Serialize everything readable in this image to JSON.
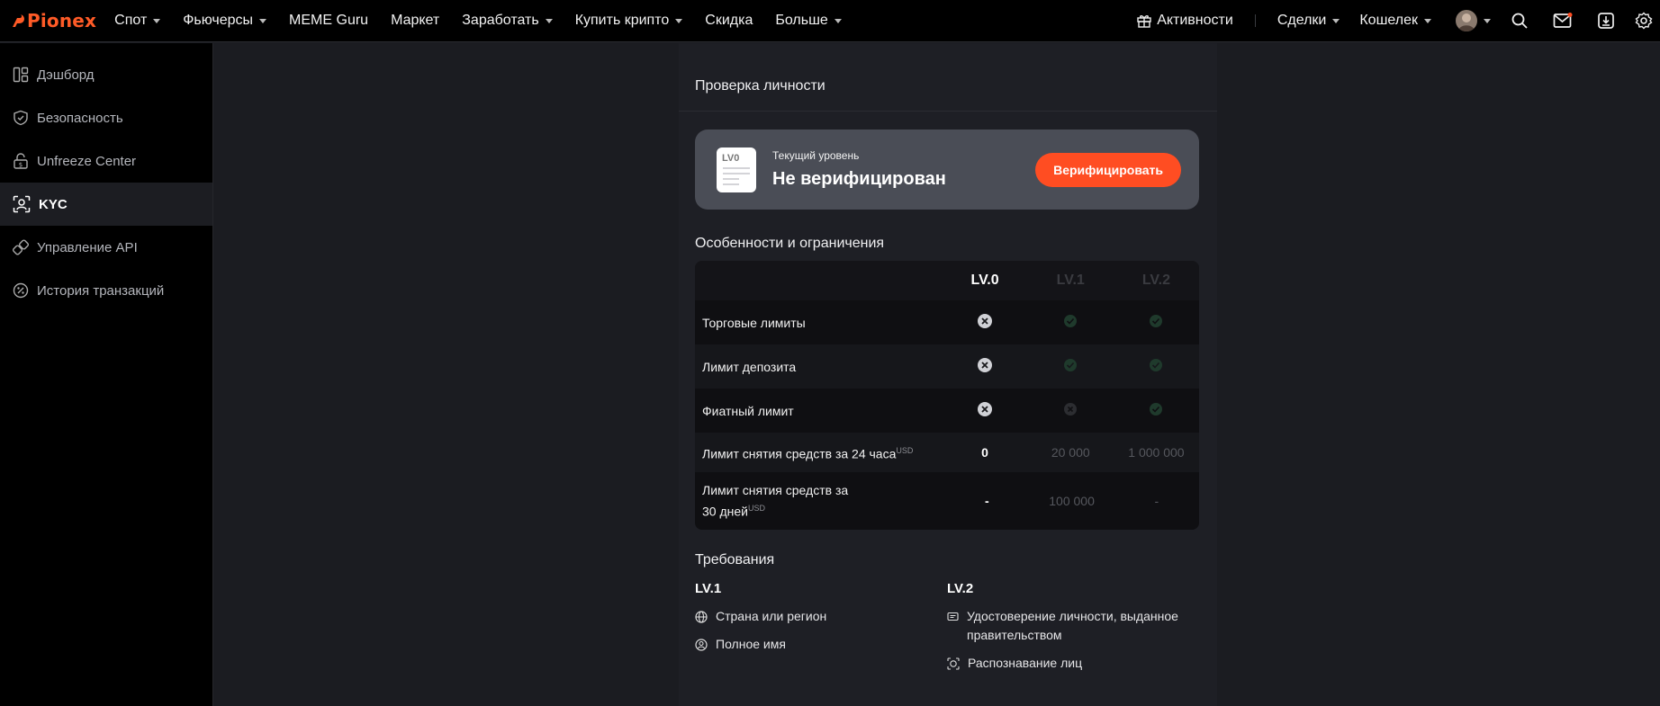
{
  "brand": {
    "name": "Pionex",
    "accent": "#ff5b27"
  },
  "nav": [
    {
      "label": "Спот",
      "caret": true
    },
    {
      "label": "Фьючерсы",
      "caret": true
    },
    {
      "label": "MEME Guru",
      "caret": false
    },
    {
      "label": "Маркет",
      "caret": false
    },
    {
      "label": "Заработать",
      "caret": true
    },
    {
      "label": "Купить крипто",
      "caret": true
    },
    {
      "label": "Скидка",
      "caret": false
    },
    {
      "label": "Больше",
      "caret": true
    }
  ],
  "right_nav": {
    "activities": "Активности",
    "deals": "Сделки",
    "wallet": "Кошелек"
  },
  "sidebar": [
    {
      "label": "Дэшборд",
      "icon": "dashboard-icon"
    },
    {
      "label": "Безопасность",
      "icon": "shield-icon"
    },
    {
      "label": "Unfreeze Center",
      "icon": "unlock-icon"
    },
    {
      "label": "KYC",
      "icon": "user-scan-icon",
      "active": true
    },
    {
      "label": "Управление API",
      "icon": "api-link-icon"
    },
    {
      "label": "История транзакций",
      "icon": "percent-icon"
    }
  ],
  "page": {
    "title": "Проверка личности",
    "badge": "LV0",
    "current_level_label": "Текущий уровень",
    "current_level_value": "Не верифицирован",
    "verify_button": "Верифицировать"
  },
  "features": {
    "title": "Особенности и ограничения",
    "columns": [
      "LV.0",
      "LV.1",
      "LV.2"
    ],
    "rows": [
      {
        "label": "Торговые лимиты",
        "unit": "",
        "cells": [
          "x",
          "check",
          "check"
        ]
      },
      {
        "label": "Лимит депозита",
        "unit": "",
        "cells": [
          "x",
          "check",
          "check"
        ]
      },
      {
        "label": "Фиатный лимит",
        "unit": "",
        "cells": [
          "x",
          "x-dim",
          "check"
        ]
      },
      {
        "label": "Лимит снятия средств за 24 часа",
        "unit": "USD",
        "cells": [
          "0",
          "20 000",
          "1 000 000"
        ]
      },
      {
        "label": "Лимит снятия средств за 30 дней",
        "unit": "USD",
        "cells": [
          "-",
          "100 000",
          "-"
        ]
      }
    ]
  },
  "requirements": {
    "title": "Требования",
    "lv1": {
      "title": "LV.1",
      "items": [
        {
          "label": "Страна или регион",
          "icon": "globe-icon"
        },
        {
          "label": "Полное имя",
          "icon": "user-circle-icon"
        }
      ]
    },
    "lv2": {
      "title": "LV.2",
      "items": [
        {
          "label": "Удостоверение личности, выданное правительством",
          "icon": "id-card-icon"
        },
        {
          "label": "Распознавание лиц",
          "icon": "face-scan-icon"
        }
      ]
    }
  }
}
